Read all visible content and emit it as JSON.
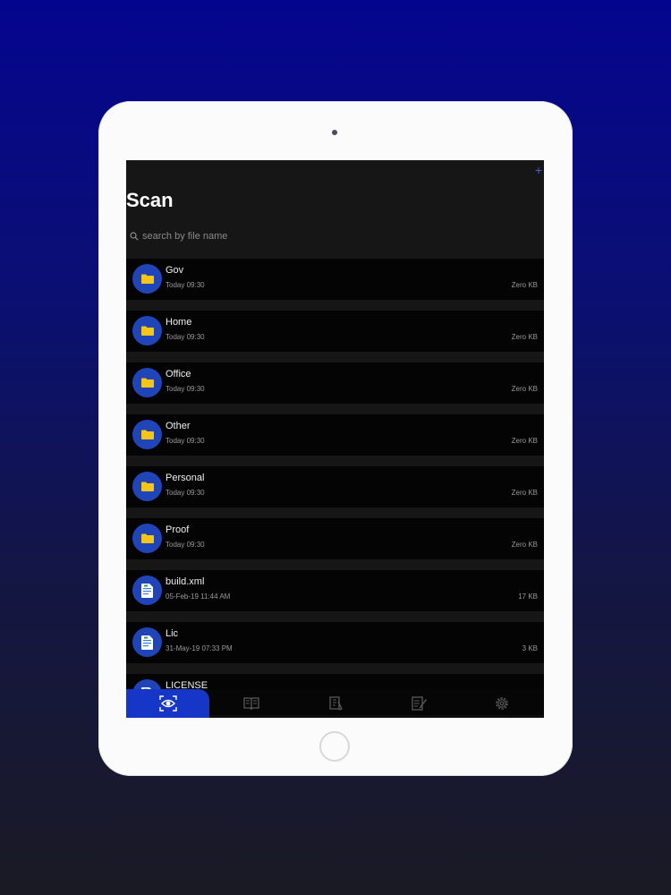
{
  "header": {
    "title": "Scan",
    "add_icon": "plus-icon"
  },
  "search": {
    "placeholder": "search by file name",
    "icon": "search-icon"
  },
  "files": [
    {
      "name": "Gov",
      "date": "Today 09:30",
      "size": "Zero KB",
      "type": "folder"
    },
    {
      "name": "Home",
      "date": "Today 09:30",
      "size": "Zero KB",
      "type": "folder"
    },
    {
      "name": "Office",
      "date": "Today 09:30",
      "size": "Zero KB",
      "type": "folder"
    },
    {
      "name": "Other",
      "date": "Today 09:30",
      "size": "Zero KB",
      "type": "folder"
    },
    {
      "name": "Personal",
      "date": "Today 09:30",
      "size": "Zero KB",
      "type": "folder"
    },
    {
      "name": "Proof",
      "date": "Today 09:30",
      "size": "Zero KB",
      "type": "folder"
    },
    {
      "name": "build.xml",
      "date": "05-Feb-19 11:44 AM",
      "size": "17 KB",
      "type": "document"
    },
    {
      "name": "Lic",
      "date": "31-May-19 07:33 PM",
      "size": "3 KB",
      "type": "document"
    },
    {
      "name": "LICENSE",
      "date": "",
      "size": "",
      "type": "document"
    }
  ],
  "tabs": [
    {
      "icon": "scan-eye-icon",
      "active": true
    },
    {
      "icon": "book-icon",
      "active": false
    },
    {
      "icon": "documents-icon",
      "active": false
    },
    {
      "icon": "edit-document-icon",
      "active": false
    },
    {
      "icon": "gear-icon",
      "active": false
    }
  ],
  "colors": {
    "accent": "#1536c7",
    "icon_circle": "#1f45b8",
    "folder": "#f5c518",
    "background": "#161616"
  }
}
